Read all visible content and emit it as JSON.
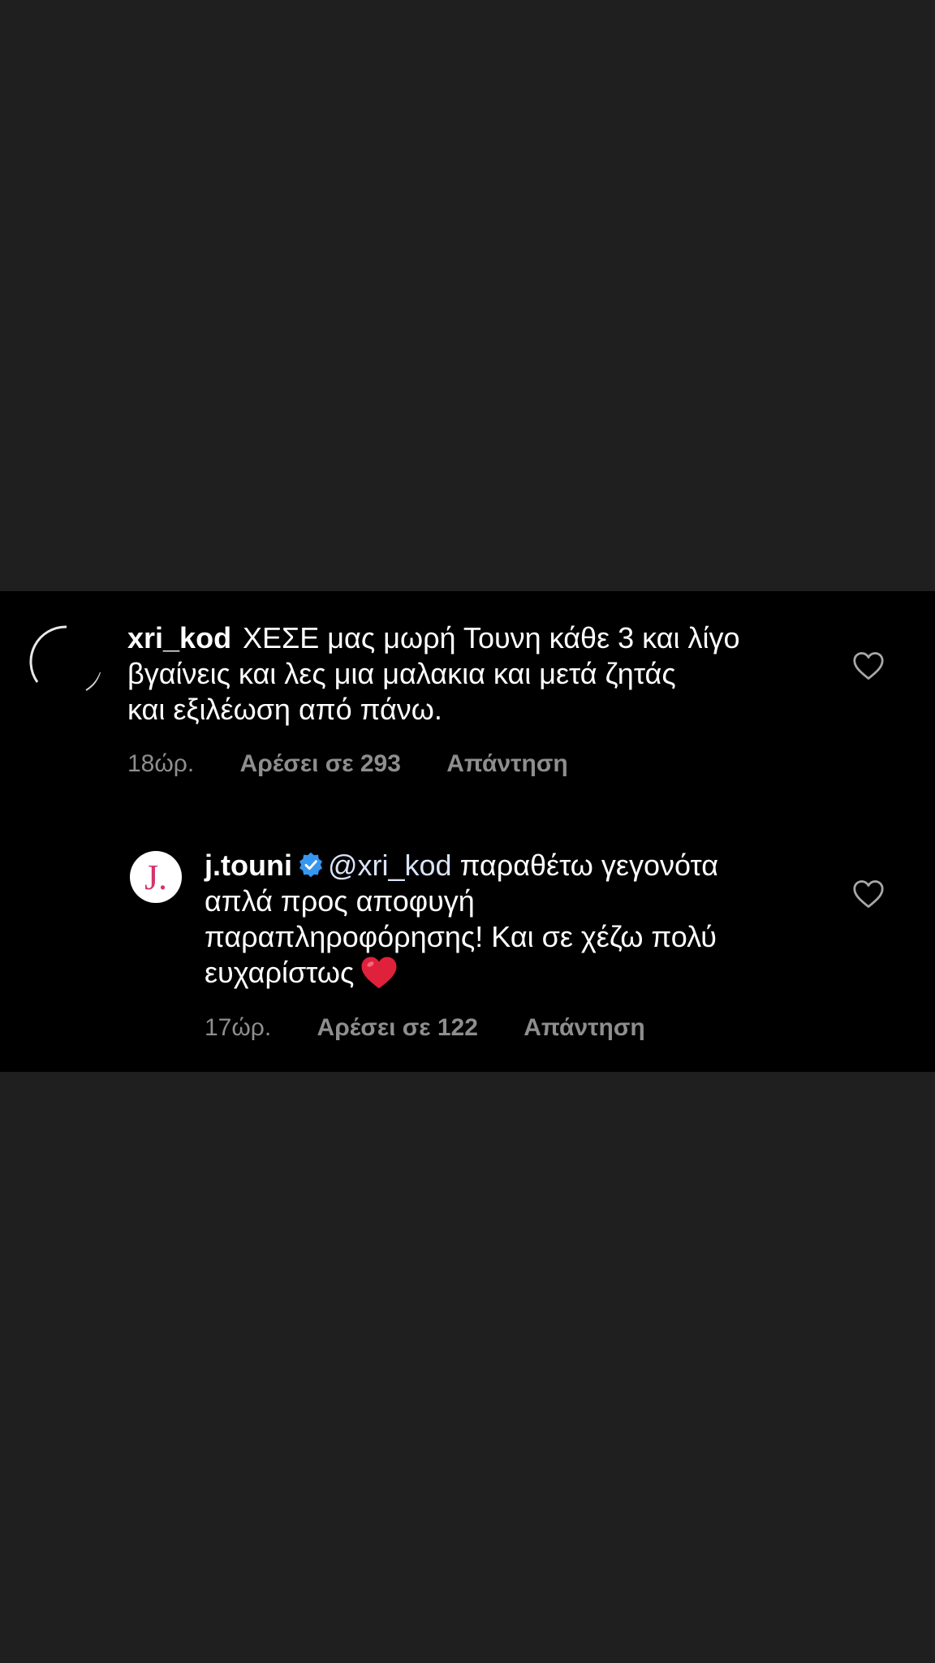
{
  "comments": [
    {
      "username": "xri_kod",
      "text_lines": [
        "ΧΕΣΕ μας μωρή Τουνη κάθε 3 και λίγο",
        "βγαίνεις και λες μια μαλακια και μετά ζητάς",
        "και εξιλέωση από πάνω."
      ],
      "time": "18ώρ.",
      "likes_label": "Αρέσει σε 293",
      "reply_label": "Απάντηση",
      "like_icon": "heart-outline-icon"
    },
    {
      "username": "j.touni",
      "verified": true,
      "avatar_letter": "J.",
      "mention": "@xri_kod",
      "text_first": "παραθέτω γεγονότα",
      "text_lines": [
        "απλά προς αποφυγή",
        "παραπληροφόρησης! Και σε χέζω πολύ",
        "ευχαρίστως"
      ],
      "emoji": "❤️",
      "time": "17ώρ.",
      "likes_label": "Αρέσει σε 122",
      "reply_label": "Απάντηση",
      "like_icon": "heart-outline-icon"
    }
  ],
  "colors": {
    "background": "#1f1f1f",
    "panel": "#000000",
    "text": "#ffffff",
    "meta": "#8e8e8e",
    "verified": "#3797f0",
    "logo": "#d6326d",
    "heart_emoji": "#e0213c"
  }
}
